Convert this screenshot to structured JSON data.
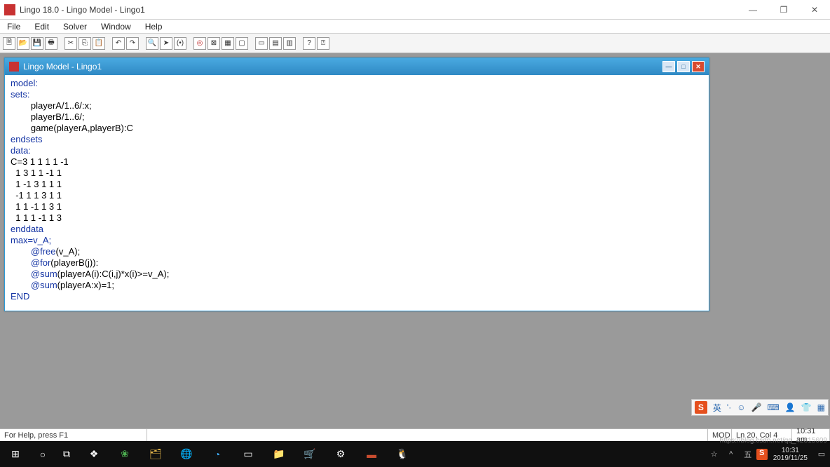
{
  "titlebar": {
    "title": "Lingo 18.0 - Lingo Model - Lingo1"
  },
  "menubar": [
    "File",
    "Edit",
    "Solver",
    "Window",
    "Help"
  ],
  "child_window": {
    "title": "Lingo Model - Lingo1"
  },
  "code": {
    "l1": "model:",
    "l2": "sets:",
    "l3": "        playerA/1..6/:x;",
    "l4": "        playerB/1..6/;",
    "l5": "        game(playerA,playerB):C",
    "l6": "endsets",
    "l7": "data:",
    "l8": "C=3 1 1 1 1 -1",
    "l9": "  1 3 1 1 -1 1",
    "l10": "  1 -1 3 1 1 1",
    "l11": "  -1 1 1 3 1 1",
    "l12": "  1 1 -1 1 3 1",
    "l13": "  1 1 1 -1 1 3",
    "l14": "enddata",
    "l15": "max=v_A;",
    "l16a": "        ",
    "l16b": "@free",
    "l16c": "(v_A);",
    "l17a": "        ",
    "l17b": "@for",
    "l17c": "(playerB(j)):",
    "l18a": "        ",
    "l18b": "@sum",
    "l18c": "(playerA(i):C(i,j)*x(i)>=v_A);",
    "l19a": "        ",
    "l19b": "@sum",
    "l19c": "(playerA:x)=1;",
    "l20": "END"
  },
  "ime": {
    "s": "S",
    "lang": "英",
    "quote": "'·",
    "smile": "☺",
    "mic": "🎤",
    "kb": "⌨",
    "user": "👤",
    "shirt": "👕",
    "grid": "▦"
  },
  "status": {
    "help": "For Help, press F1",
    "mod": "MOD",
    "pos": "Ln 20, Col 4",
    "time": "10:31 am"
  },
  "tray": {
    "time": "10:31",
    "date": "2019/11/25",
    "people": "☆",
    "up": "^",
    "ime": "五",
    "s": "S",
    "net": "▭"
  },
  "taskbar_icons": [
    "⊞",
    "○",
    "⧉",
    "❖",
    "❀",
    "🗂",
    "🌐",
    "◔",
    "▭",
    "📁",
    "🛒",
    "⚙",
    "▬",
    "🐧"
  ],
  "watermark": "https://blog.csdn.net/qq_42815609"
}
